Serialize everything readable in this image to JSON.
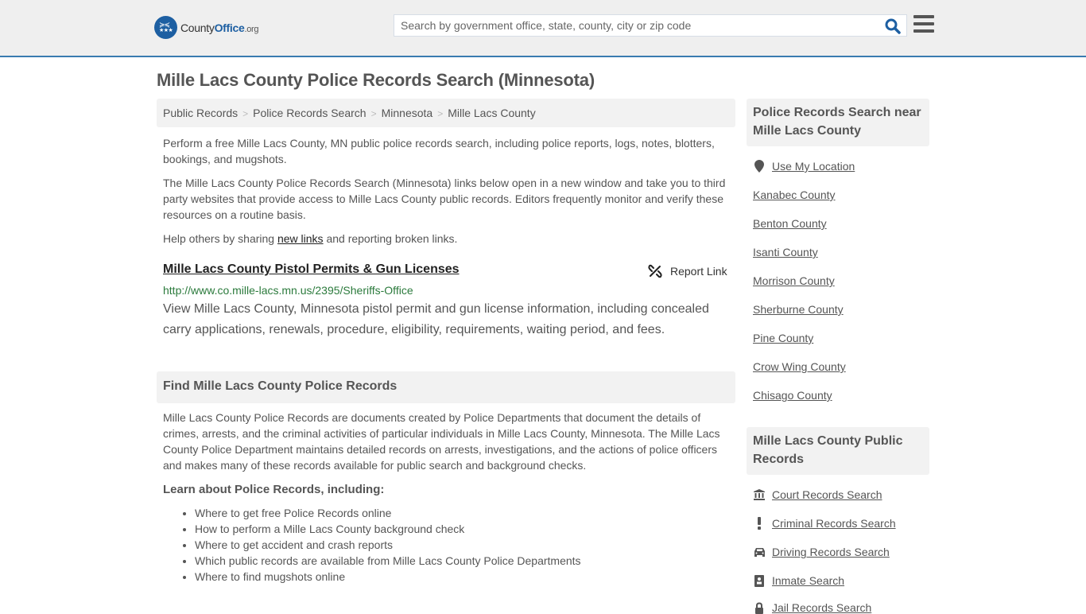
{
  "header": {
    "logo_text_county": "County",
    "logo_text_office": "Office",
    "logo_text_org": ".org",
    "search_placeholder": "Search by government office, state, county, city or zip code",
    "search_value": ""
  },
  "page": {
    "title": "Mille Lacs County Police Records Search (Minnesota)"
  },
  "breadcrumb": [
    {
      "label": "Public Records"
    },
    {
      "label": "Police Records Search"
    },
    {
      "label": "Minnesota"
    },
    {
      "label": "Mille Lacs County"
    }
  ],
  "breadcrumb_separator": ">",
  "intro": {
    "p1": "Perform a free Mille Lacs County, MN public police records search, including police reports, logs, notes, blotters, bookings, and mugshots.",
    "p2": "The Mille Lacs County Police Records Search (Minnesota) links below open in a new window and take you to third party websites that provide access to Mille Lacs County public records. Editors frequently monitor and verify these resources on a routine basis.",
    "p3_before": "Help others by sharing ",
    "p3_link": "new links",
    "p3_after": " and reporting broken links."
  },
  "results": [
    {
      "title": "Mille Lacs County Pistol Permits & Gun Licenses",
      "url": "http://www.co.mille-lacs.mn.us/2395/Sheriffs-Office",
      "description": "View Mille Lacs County, Minnesota pistol permit and gun license information, including concealed carry applications, renewals, procedure, eligibility, requirements, waiting period, and fees.",
      "report_label": "Report Link"
    }
  ],
  "find_section": {
    "heading": "Find Mille Lacs County Police Records",
    "body": "Mille Lacs County Police Records are documents created by Police Departments that document the details of crimes, arrests, and the criminal activities of particular individuals in Mille Lacs County, Minnesota. The Mille Lacs County Police Department maintains detailed records on arrests, investigations, and the actions of police officers and makes many of these records available for public search and background checks.",
    "learn_heading": "Learn about Police Records, including:",
    "learn_items": [
      "Where to get free Police Records online",
      "How to perform a Mille Lacs County background check",
      "Where to get accident and crash reports",
      "Which public records are available from Mille Lacs County Police Departments",
      "Where to find mugshots online"
    ]
  },
  "sidebar": {
    "nearby_heading": "Police Records Search near Mille Lacs County",
    "use_location": "Use My Location",
    "nearby": [
      "Kanabec County",
      "Benton County",
      "Isanti County",
      "Morrison County",
      "Sherburne County",
      "Pine County",
      "Crow Wing County",
      "Chisago County"
    ],
    "public_heading": "Mille Lacs County Public Records",
    "public_links": [
      {
        "label": "Court Records Search",
        "icon": "courthouse-icon"
      },
      {
        "label": "Criminal Records Search",
        "icon": "exclamation-icon"
      },
      {
        "label": "Driving Records Search",
        "icon": "car-icon"
      },
      {
        "label": "Inmate Search",
        "icon": "id-card-icon"
      },
      {
        "label": "Jail Records Search",
        "icon": "lock-icon"
      }
    ]
  },
  "colors": {
    "brand_blue": "#1d5fa2",
    "header_border": "#3a7bb0",
    "url_green": "#2b7a3c"
  }
}
